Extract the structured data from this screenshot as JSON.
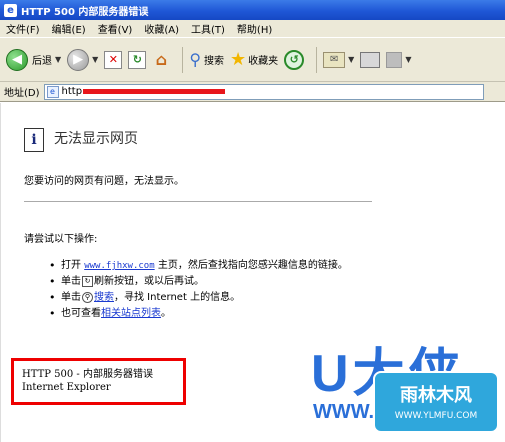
{
  "window": {
    "title": "HTTP 500 内部服务器错误"
  },
  "menu": [
    "文件(F)",
    "编辑(E)",
    "查看(V)",
    "收藏(A)",
    "工具(T)",
    "帮助(H)"
  ],
  "toolbar": {
    "back_label": "后退",
    "search_label": "搜索",
    "favorites_label": "收藏夹",
    "icons": [
      "back-icon",
      "forward-icon",
      "stop-icon",
      "refresh-icon",
      "home-icon",
      "search-icon",
      "star-icon",
      "history-icon",
      "mail-icon",
      "print-icon"
    ]
  },
  "address": {
    "label": "地址(D)",
    "value": "http"
  },
  "page": {
    "heading": "无法显示网页",
    "message": "您要访问的网页有问题，无法显示。",
    "try_label": "请尝试以下操作:",
    "bullet1_pre": "打开 ",
    "bullet1_url": "www.fjhxw.com",
    "bullet1_post": " 主页，然后查找指向您感兴趣信息的链接。",
    "bullet2_pre": "单击",
    "bullet2_post": "刷新按钮，或以后再试。",
    "bullet3_pre": "单击",
    "bullet3_link": "搜索",
    "bullet3_post": "，寻找 Internet 上的信息。",
    "bullet4_pre": "也可查看",
    "bullet4_link": "相关站点列表",
    "bullet4_post": "。",
    "error_line1": "HTTP 500 - 内部服务器错误",
    "error_line2": "Internet Explorer"
  },
  "watermark": {
    "letters": "U大侠",
    "url": "WWW.U",
    "badge_title": "雨林木风",
    "badge_url": "WWW.YLMFU.COM"
  },
  "colors": {
    "titlebar": "#1f57d6",
    "link": "#1a3ad0",
    "error_box": "#e00000",
    "watermark": "#2a6fd8"
  }
}
